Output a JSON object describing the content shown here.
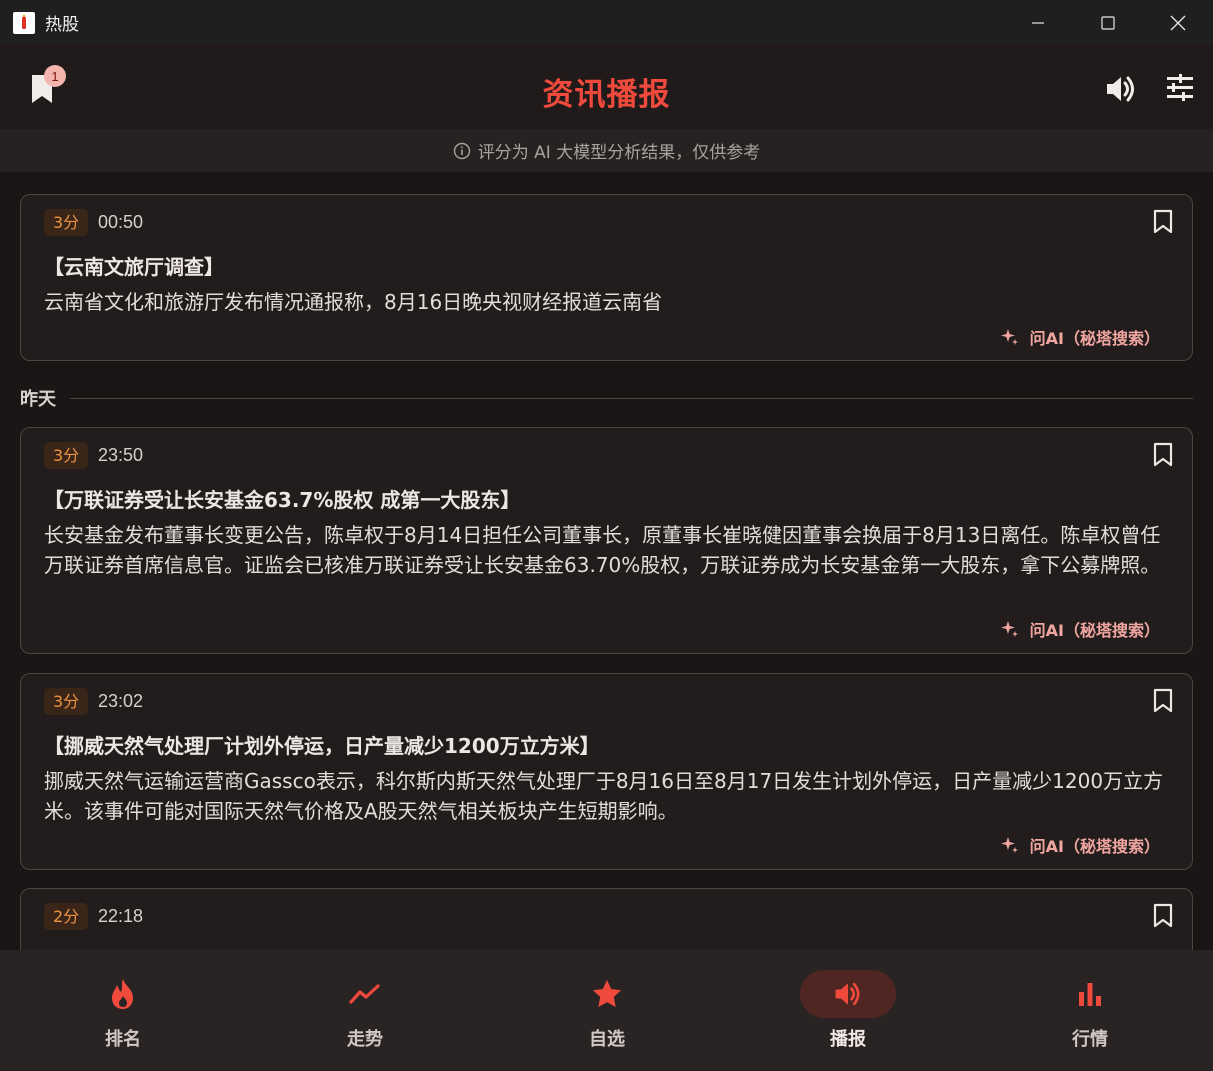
{
  "window": {
    "title": "热股"
  },
  "header": {
    "title": "资讯播报",
    "bookmark_badge": "1"
  },
  "disclaimer": {
    "text": "评分为 AI 大模型分析结果，仅供参考"
  },
  "feed": {
    "cards": [
      {
        "score": "3分",
        "time": "00:50",
        "headline": "【云南文旅厅调查】",
        "body": "云南省文化和旅游厅发布情况通报称，8月16日晚央视财经报道云南省",
        "ask_ai": "问AI（秘塔搜索）"
      },
      {
        "score": "3分",
        "time": "23:50",
        "headline": "【万联证券受让长安基金63.7%股权 成第一大股东】",
        "body": "长安基金发布董事长变更公告，陈卓权于8月14日担任公司董事长，原董事长崔晓健因董事会换届于8月13日离任。陈卓权曾任万联证券首席信息官。证监会已核准万联证券受让长安基金63.70%股权，万联证券成为长安基金第一大股东，拿下公募牌照。",
        "ask_ai": "问AI（秘塔搜索）"
      },
      {
        "score": "3分",
        "time": "23:02",
        "headline": "【挪威天然气处理厂计划外停运，日产量减少1200万立方米】",
        "body": "挪威天然气运输运营商Gassco表示，科尔斯内斯天然气处理厂于8月16日至8月17日发生计划外停运，日产量减少1200万立方米。该事件可能对国际天然气价格及A股天然气相关板块产生短期影响。",
        "ask_ai": "问AI（秘塔搜索）"
      },
      {
        "score": "2分",
        "time": "22:18"
      }
    ],
    "date_separator": "昨天"
  },
  "bottom_nav": {
    "items": [
      {
        "label": "排名",
        "icon": "flame-icon"
      },
      {
        "label": "走势",
        "icon": "trend-icon"
      },
      {
        "label": "自选",
        "icon": "star-icon"
      },
      {
        "label": "播报",
        "icon": "speaker-icon"
      },
      {
        "label": "行情",
        "icon": "bar-chart-icon"
      }
    ],
    "active": "播报"
  },
  "colors": {
    "accent": "#ef4a3c",
    "score_text": "#ef9340",
    "ask_ai": "#f0a6a0",
    "background": "#1b1616"
  }
}
